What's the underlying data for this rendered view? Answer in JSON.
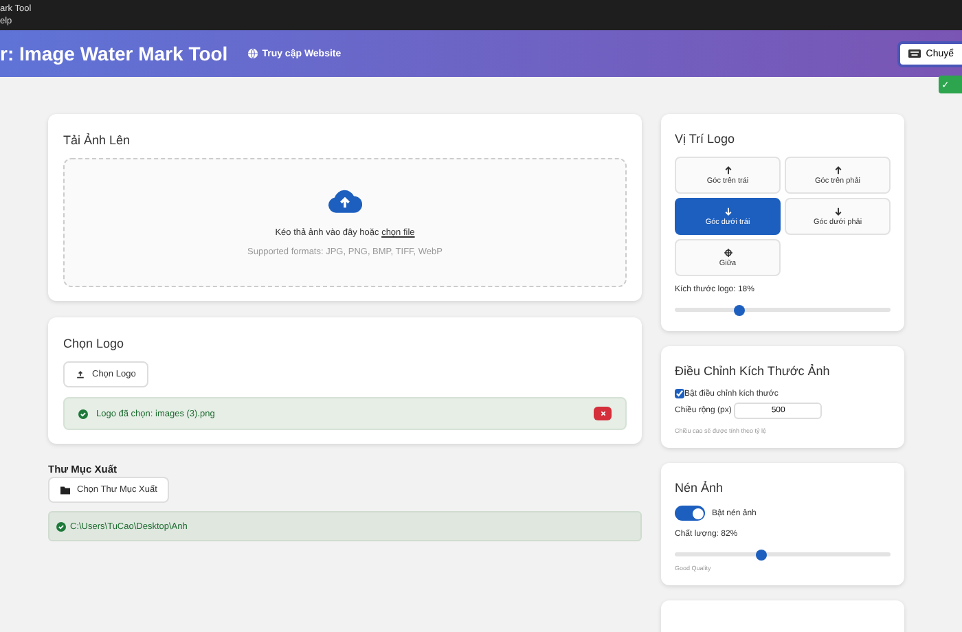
{
  "top_bar": {
    "lines": [
      "ark Tool",
      "elp"
    ]
  },
  "header": {
    "title": "r: Image Water Mark Tool",
    "link": "Truy cập Website",
    "button": "Chuyể"
  },
  "toast": {
    "text": "✓"
  },
  "upload": {
    "title": "Tải Ảnh Lên",
    "prompt": "Kéo thả ảnh vào đây hoặc ",
    "link": "chọn file",
    "formats": "Supported formats: JPG, PNG, BMP, TIFF, WebP"
  },
  "logo": {
    "title": "Chọn Logo",
    "button": "Chọn Logo",
    "status": "Logo đã chọn: images (3).png"
  },
  "output": {
    "title": "Thư Mục Xuất",
    "button": "Chọn Thư Mục Xuất",
    "path": "C:\\Users\\TuCao\\Desktop\\Anh"
  },
  "position": {
    "title": "Vị Trí Logo",
    "options": [
      {
        "label": "Góc trên trái",
        "kind": "up",
        "selected": false
      },
      {
        "label": "Góc trên phải",
        "kind": "up",
        "selected": false
      },
      {
        "label": "Góc dưới trái",
        "kind": "down",
        "selected": true
      },
      {
        "label": "Góc dưới phải",
        "kind": "down",
        "selected": false
      },
      {
        "label": "Giữa",
        "kind": "center",
        "selected": false
      }
    ],
    "size_label": "Kích thước logo: 18%",
    "size": {
      "level": 0.3
    }
  },
  "resize": {
    "title": "Điều Chỉnh Kích Thước Ảnh",
    "checkbox": {
      "label": "Bật điều chỉnh kích thước",
      "checked": true
    },
    "width_label": "Chiều rộng (px)",
    "width_value": "500",
    "note": "Chiều cao sẽ được tính theo tỷ lệ"
  },
  "compress": {
    "title": "Nén Ảnh",
    "toggle": {
      "label": "Bật nén ảnh",
      "on": true
    },
    "quality_label": "Chất lượng: 82%",
    "quality": {
      "level": 0.4
    },
    "quality_note": "Good Quality"
  }
}
